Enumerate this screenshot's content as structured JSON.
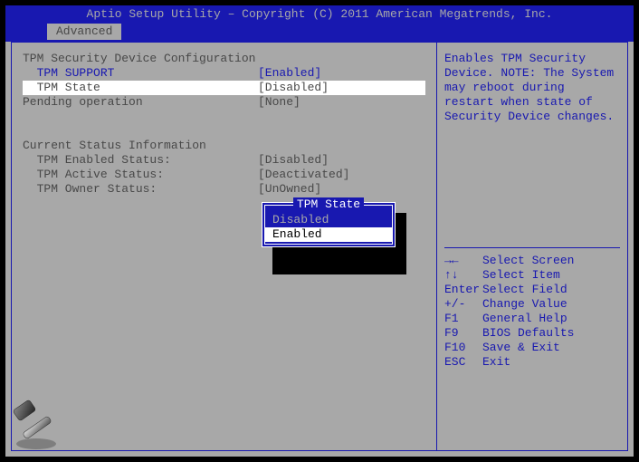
{
  "title": "Aptio Setup Utility – Copyright (C) 2011 American Megatrends, Inc.",
  "tab": "Advanced",
  "section_header": "TPM Security Device Configuration",
  "items": {
    "tpm_support": {
      "label": "  TPM SUPPORT",
      "value": "[Enabled]"
    },
    "tpm_state": {
      "label": "  TPM State",
      "value": "[Disabled]"
    },
    "pending_op": {
      "label": "Pending operation",
      "value": "[None]"
    }
  },
  "status_header": "Current Status Information",
  "status": {
    "enabled": {
      "label": "  TPM Enabled Status:",
      "value": "[Disabled]"
    },
    "active": {
      "label": "  TPM Active Status:",
      "value": "[Deactivated]"
    },
    "owner": {
      "label": "  TPM Owner Status:",
      "value": "[UnOwned]"
    }
  },
  "popup": {
    "title": "TPM State",
    "options": [
      "Disabled",
      "Enabled"
    ],
    "selected": "Enabled"
  },
  "help_text": "Enables TPM Security Device. NOTE: The System may reboot during restart when state of Security Device changes.",
  "keys": [
    {
      "k": "→←",
      "d": "Select Screen"
    },
    {
      "k": "↑↓",
      "d": "Select Item"
    },
    {
      "k": "Enter",
      "d": "Select Field"
    },
    {
      "k": "+/-",
      "d": "Change Value"
    },
    {
      "k": "F1",
      "d": "General Help"
    },
    {
      "k": "F9",
      "d": "BIOS Defaults"
    },
    {
      "k": "F10",
      "d": "Save & Exit"
    },
    {
      "k": "ESC",
      "d": "Exit"
    }
  ]
}
